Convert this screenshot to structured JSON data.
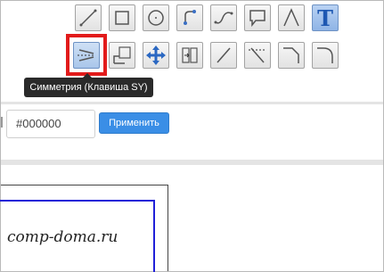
{
  "toolbar": {
    "row1": [
      {
        "name": "line-tool-icon"
      },
      {
        "name": "rectangle-tool-icon"
      },
      {
        "name": "circle-tool-icon"
      },
      {
        "name": "curve-tool-icon"
      },
      {
        "name": "spline-tool-icon"
      },
      {
        "name": "callout-tool-icon"
      },
      {
        "name": "angle-tool-icon"
      },
      {
        "name": "text-tool-icon",
        "glyph": "T"
      }
    ],
    "row2": [
      {
        "name": "symmetry-tool-icon",
        "state": "active"
      },
      {
        "name": "rotate-tool-icon"
      },
      {
        "name": "move-tool-icon"
      },
      {
        "name": "align-tool-icon"
      },
      {
        "name": "diagonal-line-tool-icon"
      },
      {
        "name": "cross-line-tool-icon"
      },
      {
        "name": "corner-tool-icon"
      },
      {
        "name": "arc-corner-tool-icon"
      }
    ]
  },
  "tooltip": {
    "text": "Симметрия (Клавиша SY)"
  },
  "color": {
    "value": "#000000",
    "apply_label": "Применить"
  },
  "watermark": {
    "text": "comp-doma.ru"
  },
  "colors": {
    "accent": "#3a8ee6",
    "highlight": "#e21b1b",
    "canvas_border": "#2020d8"
  }
}
